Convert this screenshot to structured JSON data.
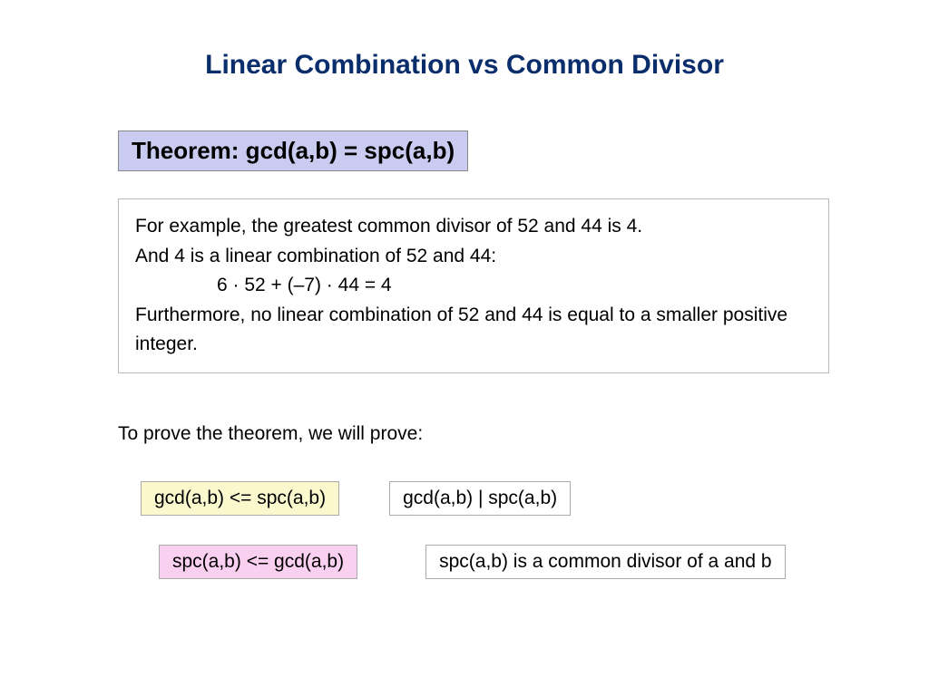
{
  "slide": {
    "title": "Linear Combination vs Common Divisor",
    "theorem": "Theorem:  gcd(a,b) = spc(a,b)",
    "example": {
      "line1": "For example, the greatest common divisor of 52 and 44 is 4.",
      "line2": "And 4 is a linear combination of 52 and 44:",
      "equation": "6 · 52 + (–7) · 44 = 4",
      "line3": "Furthermore, no linear combination of 52 and 44 is equal to a smaller positive integer."
    },
    "prove_intro": "To prove the theorem, we will prove:",
    "claims": {
      "claim1": "gcd(a,b) <= spc(a,b)",
      "claim1_detail": "gcd(a,b) | spc(a,b)",
      "claim2": "spc(a,b) <= gcd(a,b)",
      "claim2_detail": "spc(a,b) is a common divisor of a and b"
    }
  }
}
